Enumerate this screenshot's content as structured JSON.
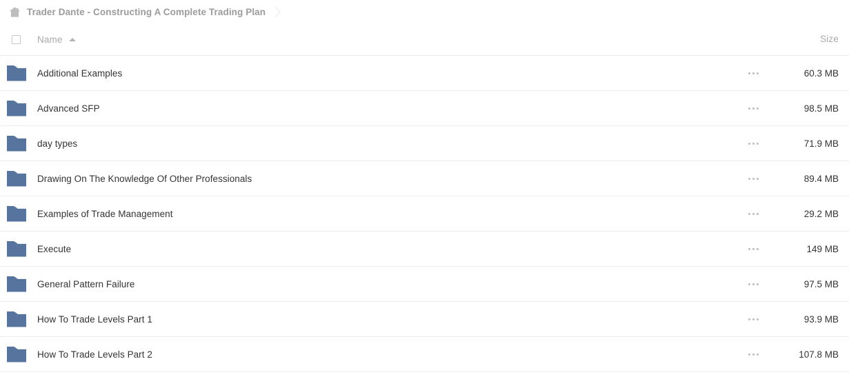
{
  "breadcrumb": {
    "home_icon": "home-icon",
    "title": "Trader Dante - Constructing A Complete Trading Plan",
    "separator_icon": "chevron-right-icon"
  },
  "columns": {
    "name_label": "Name",
    "sort_direction": "ascending",
    "sort_icon": "sort-ascending-icon",
    "size_label": "Size",
    "select_all_icon": "checkbox-unchecked-icon"
  },
  "colors": {
    "folder": "#56749e",
    "row_border": "#ececec",
    "text_primary": "#333333",
    "text_muted": "#a8a8a8",
    "breadcrumb_text": "#9b9b9b"
  },
  "rows": [
    {
      "icon": "folder-icon",
      "name": "Additional Examples",
      "size": "60.3 MB",
      "menu_icon": "more-options-icon"
    },
    {
      "icon": "folder-icon",
      "name": "Advanced SFP",
      "size": "98.5 MB",
      "menu_icon": "more-options-icon"
    },
    {
      "icon": "folder-icon",
      "name": "day types",
      "size": "71.9 MB",
      "menu_icon": "more-options-icon"
    },
    {
      "icon": "folder-icon",
      "name": "Drawing On The Knowledge Of Other Professionals",
      "size": "89.4 MB",
      "menu_icon": "more-options-icon"
    },
    {
      "icon": "folder-icon",
      "name": "Examples of Trade Management",
      "size": "29.2 MB",
      "menu_icon": "more-options-icon"
    },
    {
      "icon": "folder-icon",
      "name": "Execute",
      "size": "149 MB",
      "menu_icon": "more-options-icon"
    },
    {
      "icon": "folder-icon",
      "name": "General Pattern Failure",
      "size": "97.5 MB",
      "menu_icon": "more-options-icon"
    },
    {
      "icon": "folder-icon",
      "name": "How To Trade Levels Part 1",
      "size": "93.9 MB",
      "menu_icon": "more-options-icon"
    },
    {
      "icon": "folder-icon",
      "name": "How To Trade Levels Part 2",
      "size": "107.8 MB",
      "menu_icon": "more-options-icon"
    }
  ]
}
